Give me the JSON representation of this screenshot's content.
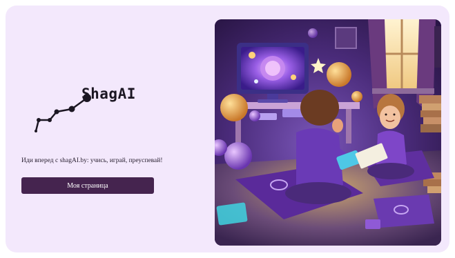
{
  "brand": {
    "logo_text": "ShagAI",
    "logo_icon": "constellation-graph-icon"
  },
  "hero": {
    "tagline": "Иди вперед с shagAI.by: учись, играй, преуспевай!",
    "cta_label": "Моя страница"
  },
  "illustration": {
    "subject": "children-learning-with-devices-illustration"
  },
  "colors": {
    "card_background": "#f3e8fc",
    "button_background": "#45244f",
    "button_text": "#ffffff",
    "accent_purple": "#7b3fc2"
  }
}
